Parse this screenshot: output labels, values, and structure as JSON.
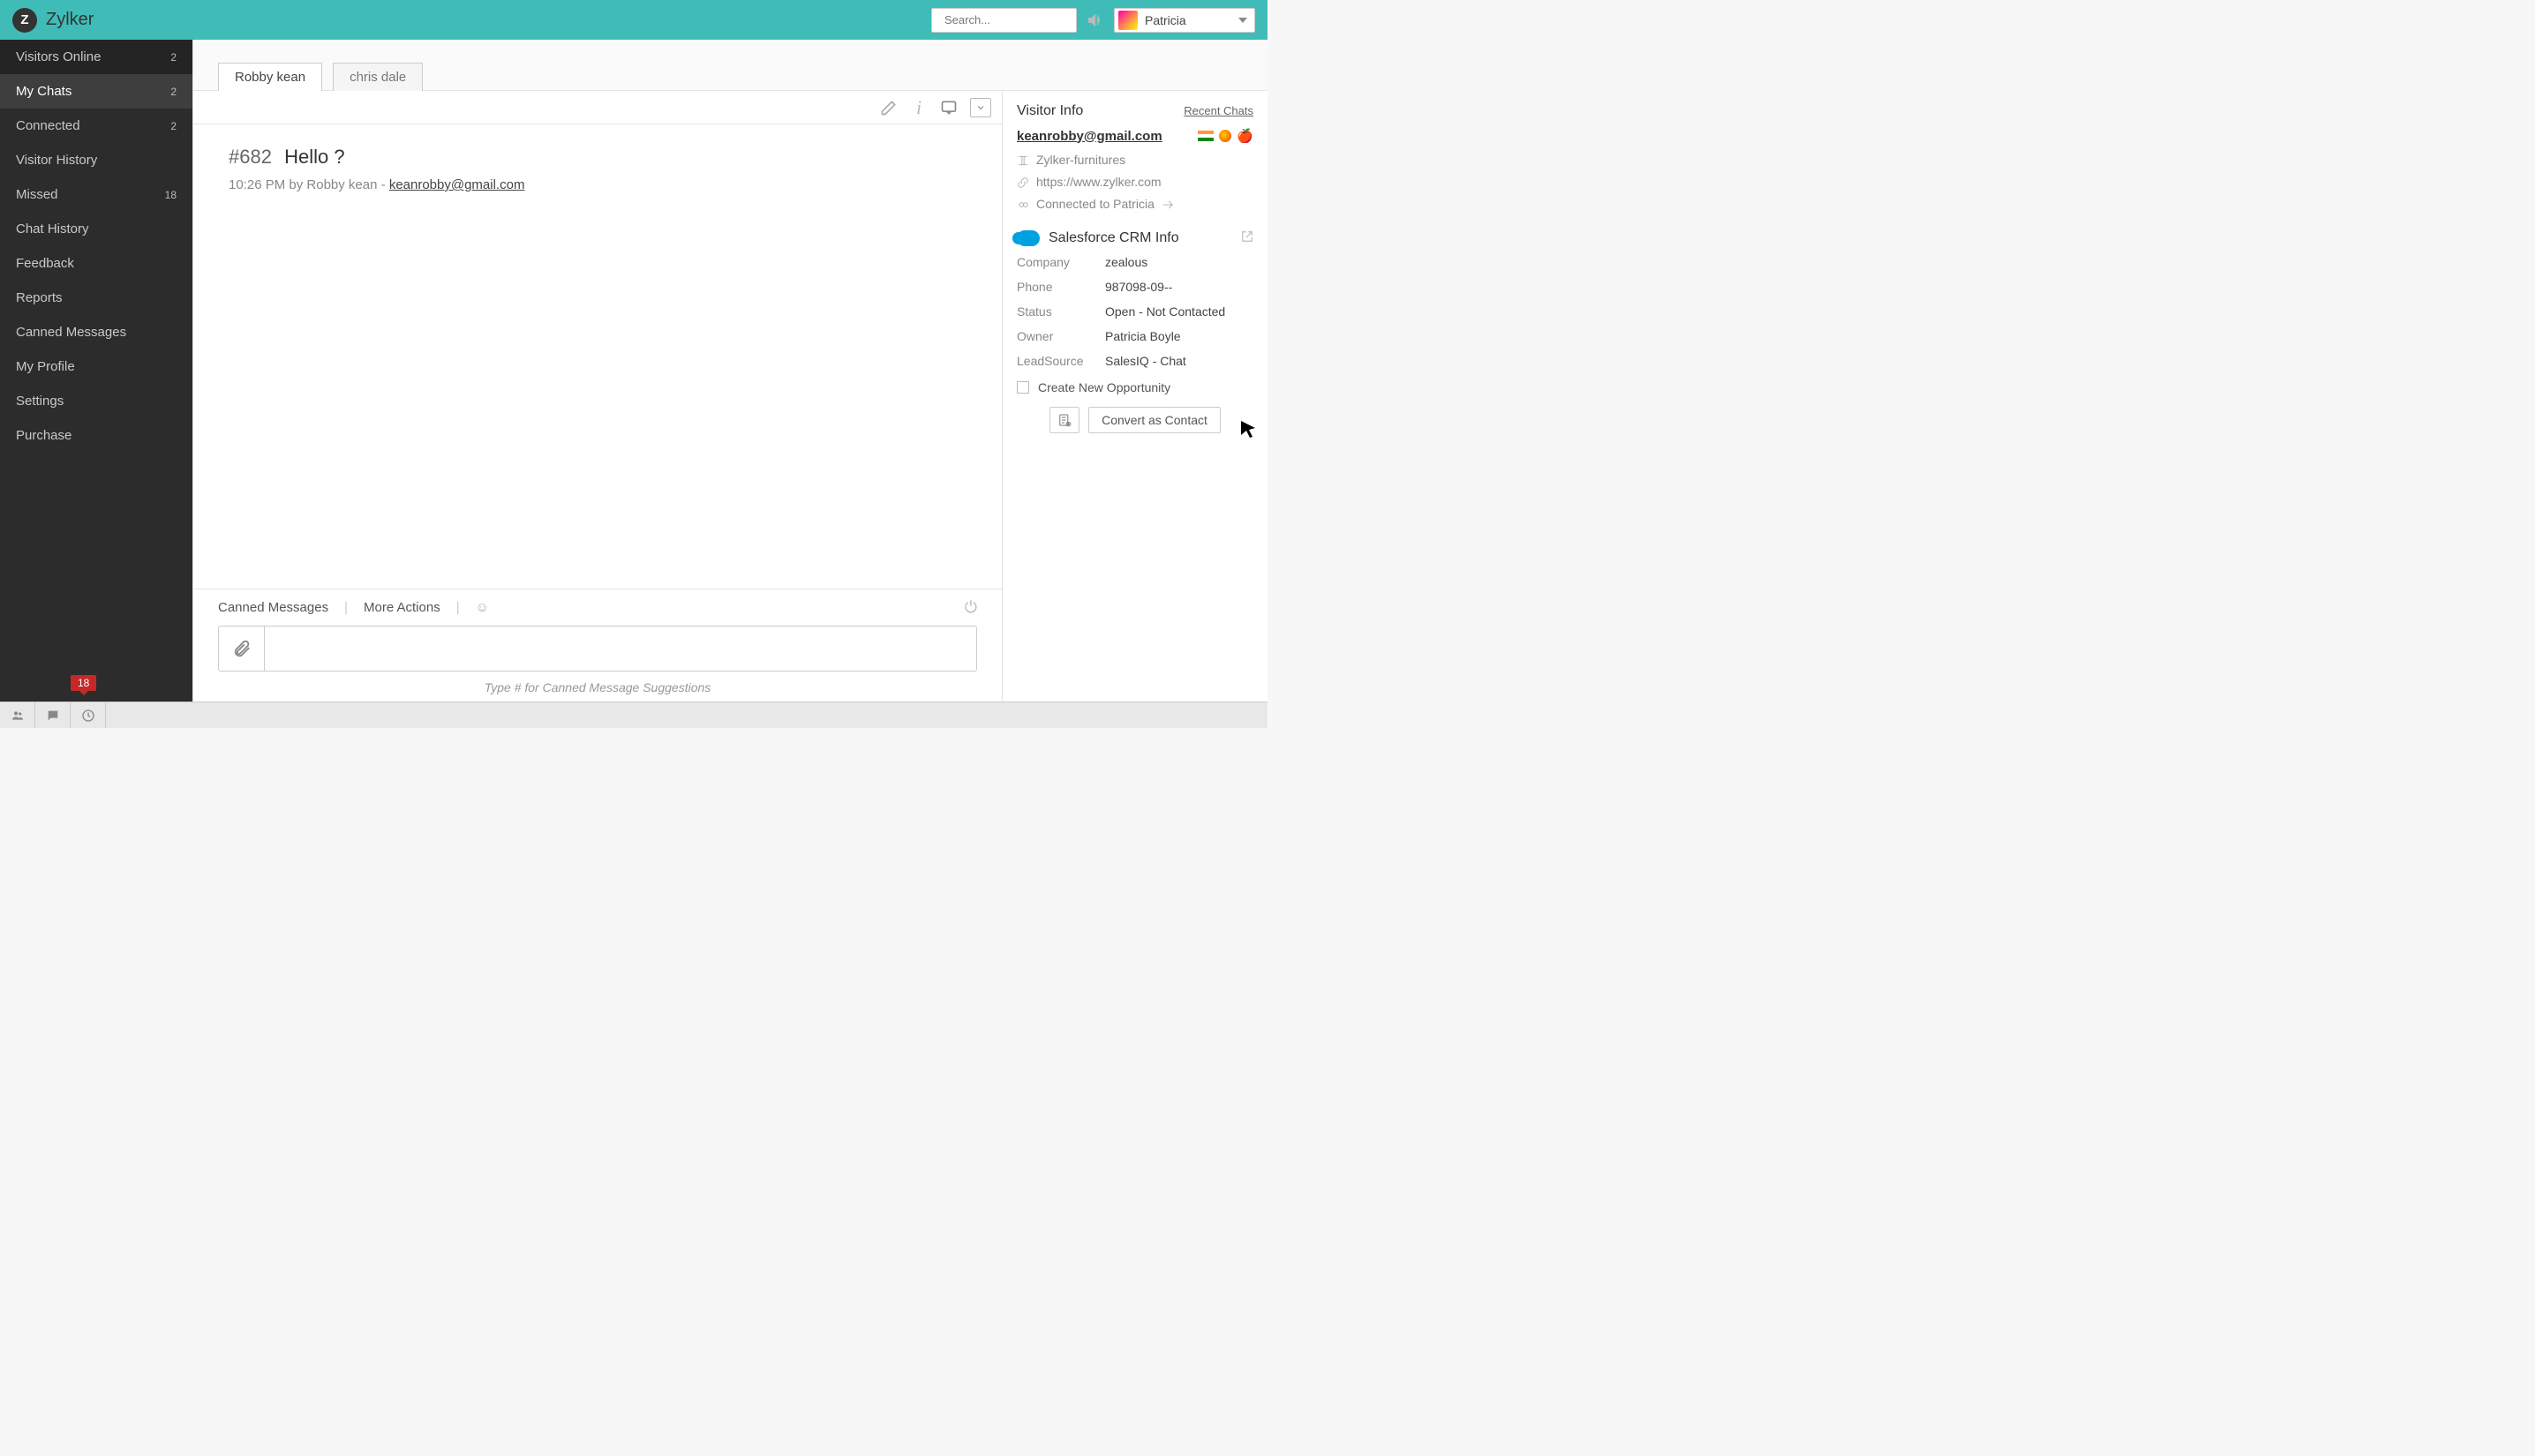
{
  "brand": {
    "logo_letter": "Z",
    "name": "Zylker"
  },
  "search": {
    "placeholder": "Search..."
  },
  "user": {
    "name": "Patricia"
  },
  "sidebar": {
    "items": [
      {
        "label": "Visitors Online",
        "badge": "2"
      },
      {
        "label": "My Chats",
        "badge": "2"
      },
      {
        "label": "Connected",
        "badge": "2"
      },
      {
        "label": "Visitor History",
        "badge": ""
      },
      {
        "label": "Missed",
        "badge": "18"
      },
      {
        "label": "Chat History",
        "badge": ""
      },
      {
        "label": "Feedback",
        "badge": ""
      },
      {
        "label": "Reports",
        "badge": ""
      },
      {
        "label": "Canned Messages",
        "badge": ""
      },
      {
        "label": "My Profile",
        "badge": ""
      },
      {
        "label": "Settings",
        "badge": ""
      },
      {
        "label": "Purchase",
        "badge": ""
      }
    ],
    "bottom_badge": "18"
  },
  "tabs": [
    {
      "label": "Robby kean"
    },
    {
      "label": "chris dale"
    }
  ],
  "conversation": {
    "ticket": "#682",
    "subject": "Hello ?",
    "time": "10:26 PM",
    "by_label": "by",
    "author": "Robby kean",
    "sep": "-",
    "email": "keanrobby@gmail.com"
  },
  "composer": {
    "canned": "Canned Messages",
    "more": "More Actions",
    "hint": "Type # for Canned Message Suggestions"
  },
  "visitor": {
    "title": "Visitor Info",
    "recent": "Recent Chats",
    "email": "keanrobby@gmail.com",
    "org": "Zylker-furnitures",
    "url": "https://www.zylker.com",
    "connected": "Connected to Patricia"
  },
  "crm": {
    "title": "Salesforce CRM Info",
    "rows": {
      "company_k": "Company",
      "company_v": "zealous",
      "phone_k": "Phone",
      "phone_v": "987098-09--",
      "status_k": "Status",
      "status_v": "Open - Not Contacted",
      "owner_k": "Owner",
      "owner_v": "Patricia Boyle",
      "lead_k": "LeadSource",
      "lead_v": "SalesIQ - Chat"
    },
    "create_opp": "Create New Opportunity",
    "convert": "Convert as Contact"
  }
}
